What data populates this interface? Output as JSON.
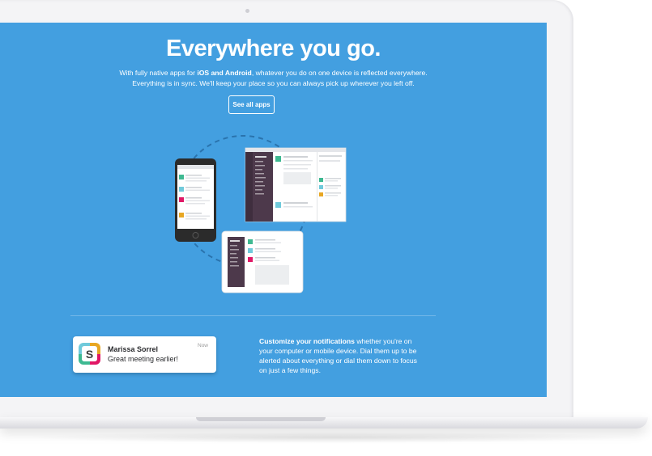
{
  "hero": {
    "headline": "Everywhere you go.",
    "desc_pre": "With fully native apps for ",
    "desc_bold": "iOS and Android",
    "desc_post": ", whatever you do on one device is reflected everywhere.",
    "desc_line2": "Everything is in sync. We'll keep your place so you can always pick up wherever you left off.",
    "button_label": "See all apps"
  },
  "notification": {
    "app_letter": "S",
    "sender": "Marissa Sorrel",
    "message": "Great meeting earlier!",
    "time": "Now"
  },
  "customize": {
    "bold": "Customize your notifications",
    "text": " whether you're on your computer or mobile device. Dial them up to be alerted about everything or dial them down to focus on just a few things."
  },
  "colors": {
    "screen_bg": "#439fe0",
    "sidebar": "#4d394b",
    "accent_green": "#3eb991",
    "accent_teal": "#70cadb",
    "accent_pink": "#e01765",
    "accent_orange": "#e8a723"
  }
}
